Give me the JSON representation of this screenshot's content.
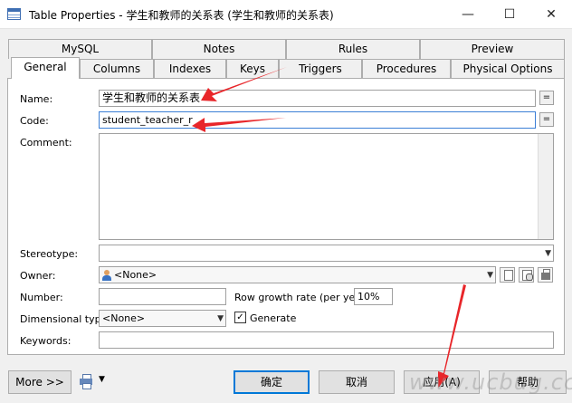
{
  "window": {
    "title": "Table Properties - 学生和教师的关系表 (学生和教师的关系表)",
    "minimize": "—",
    "maximize": "☐",
    "close": "✕"
  },
  "tabs_row1": [
    "MySQL",
    "Notes",
    "Rules",
    "Preview"
  ],
  "tabs_row2": [
    "General",
    "Columns",
    "Indexes",
    "Keys",
    "Triggers",
    "Procedures",
    "Physical Options"
  ],
  "active_tab": "General",
  "form": {
    "name_label": "Name:",
    "name_value": "学生和教师的关系表",
    "code_label": "Code:",
    "code_value": "student_teacher_r",
    "eq_symbol": "=",
    "comment_label": "Comment:",
    "stereotype_label": "Stereotype:",
    "owner_label": "Owner:",
    "owner_value": "<None>",
    "number_label": "Number:",
    "row_growth_label": "Row growth rate (per year):",
    "row_growth_value": "10%",
    "dimensional_label": "Dimensional type:",
    "dimensional_value": "<None>",
    "generate_label": "Generate",
    "generate_checked": true,
    "keywords_label": "Keywords:"
  },
  "buttons": {
    "more": "More >>",
    "ok": "确定",
    "cancel": "取消",
    "apply": "应用(A)",
    "help": "帮助"
  },
  "watermark": "www.ucbug.cc",
  "colors": {
    "arrow": "#e8262a",
    "focus_border": "#3c7fd6",
    "default_button_border": "#0078d7"
  }
}
